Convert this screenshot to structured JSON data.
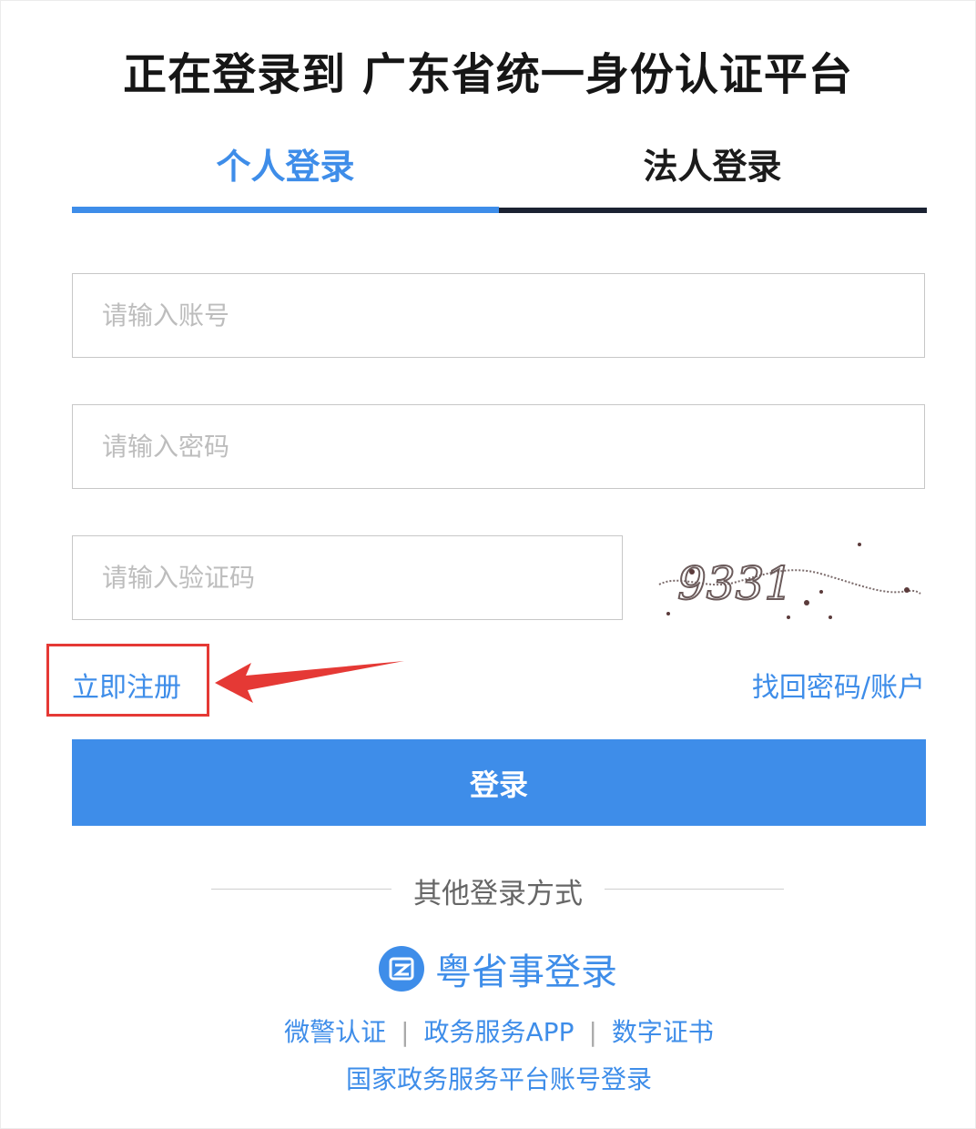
{
  "header": {
    "title": "正在登录到 广东省统一身份认证平台"
  },
  "tabs": [
    {
      "label": "个人登录",
      "active": true
    },
    {
      "label": "法人登录",
      "active": false
    }
  ],
  "form": {
    "account_placeholder": "请输入账号",
    "password_placeholder": "请输入密码",
    "captcha_placeholder": "请输入验证码",
    "captcha_text": "9331",
    "register_label": "立即注册",
    "recover_label": "找回密码/账户",
    "login_label": "登录"
  },
  "other_login": {
    "label": "其他登录方式",
    "yueshengshi_label": "粤省事登录",
    "options": [
      "微警认证",
      "政务服务APP",
      "数字证书"
    ],
    "separator": "|",
    "national_label": "国家政务服务平台账号登录"
  },
  "colors": {
    "accent": "#3e8de9",
    "annotation": "#e53935",
    "dark_tab_line": "#1b2232"
  }
}
